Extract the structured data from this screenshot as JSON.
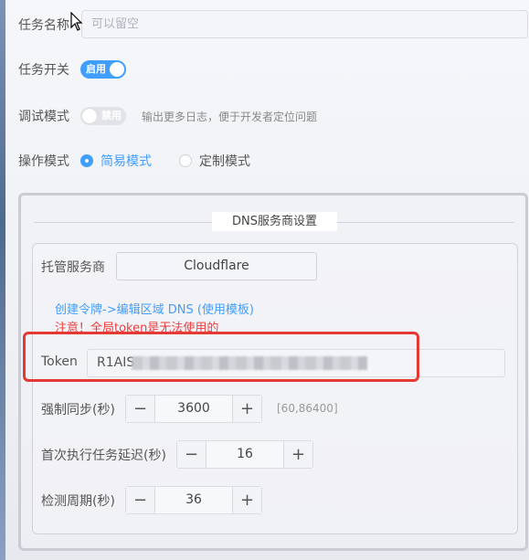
{
  "form": {
    "task_name": {
      "label": "任务名称",
      "placeholder": "可以留空"
    },
    "task_switch": {
      "label": "任务开关",
      "state": "启用"
    },
    "debug_mode": {
      "label": "调试模式",
      "state": "禁用",
      "hint": "输出更多日志，便于开发者定位问题"
    },
    "operation_mode": {
      "label": "操作模式",
      "options": [
        "简易模式",
        "定制模式"
      ],
      "selected": "简易模式"
    }
  },
  "dns_panel": {
    "title": "DNS服务商设置",
    "provider": {
      "label": "托管服务商",
      "value": "Cloudflare"
    },
    "link": "创建令牌->编辑区域 DNS (使用模板)",
    "warning": "注意！全局token是无法使用的",
    "token": {
      "label": "Token",
      "value": "R1AIS"
    },
    "force_sync": {
      "label": "强制同步(秒)",
      "value": "3600",
      "range": "[60,86400]"
    },
    "first_delay": {
      "label": "首次执行任务延迟(秒)",
      "value": "16"
    },
    "check_period": {
      "label": "检测周期(秒)",
      "value": "36"
    }
  },
  "colors": {
    "accent": "#409eff",
    "warning": "#f03c3c",
    "highlight_frame": "#e53935"
  },
  "icons": {
    "cursor": "mouse-pointer-icon",
    "minus": "minus-icon",
    "plus": "plus-icon"
  }
}
